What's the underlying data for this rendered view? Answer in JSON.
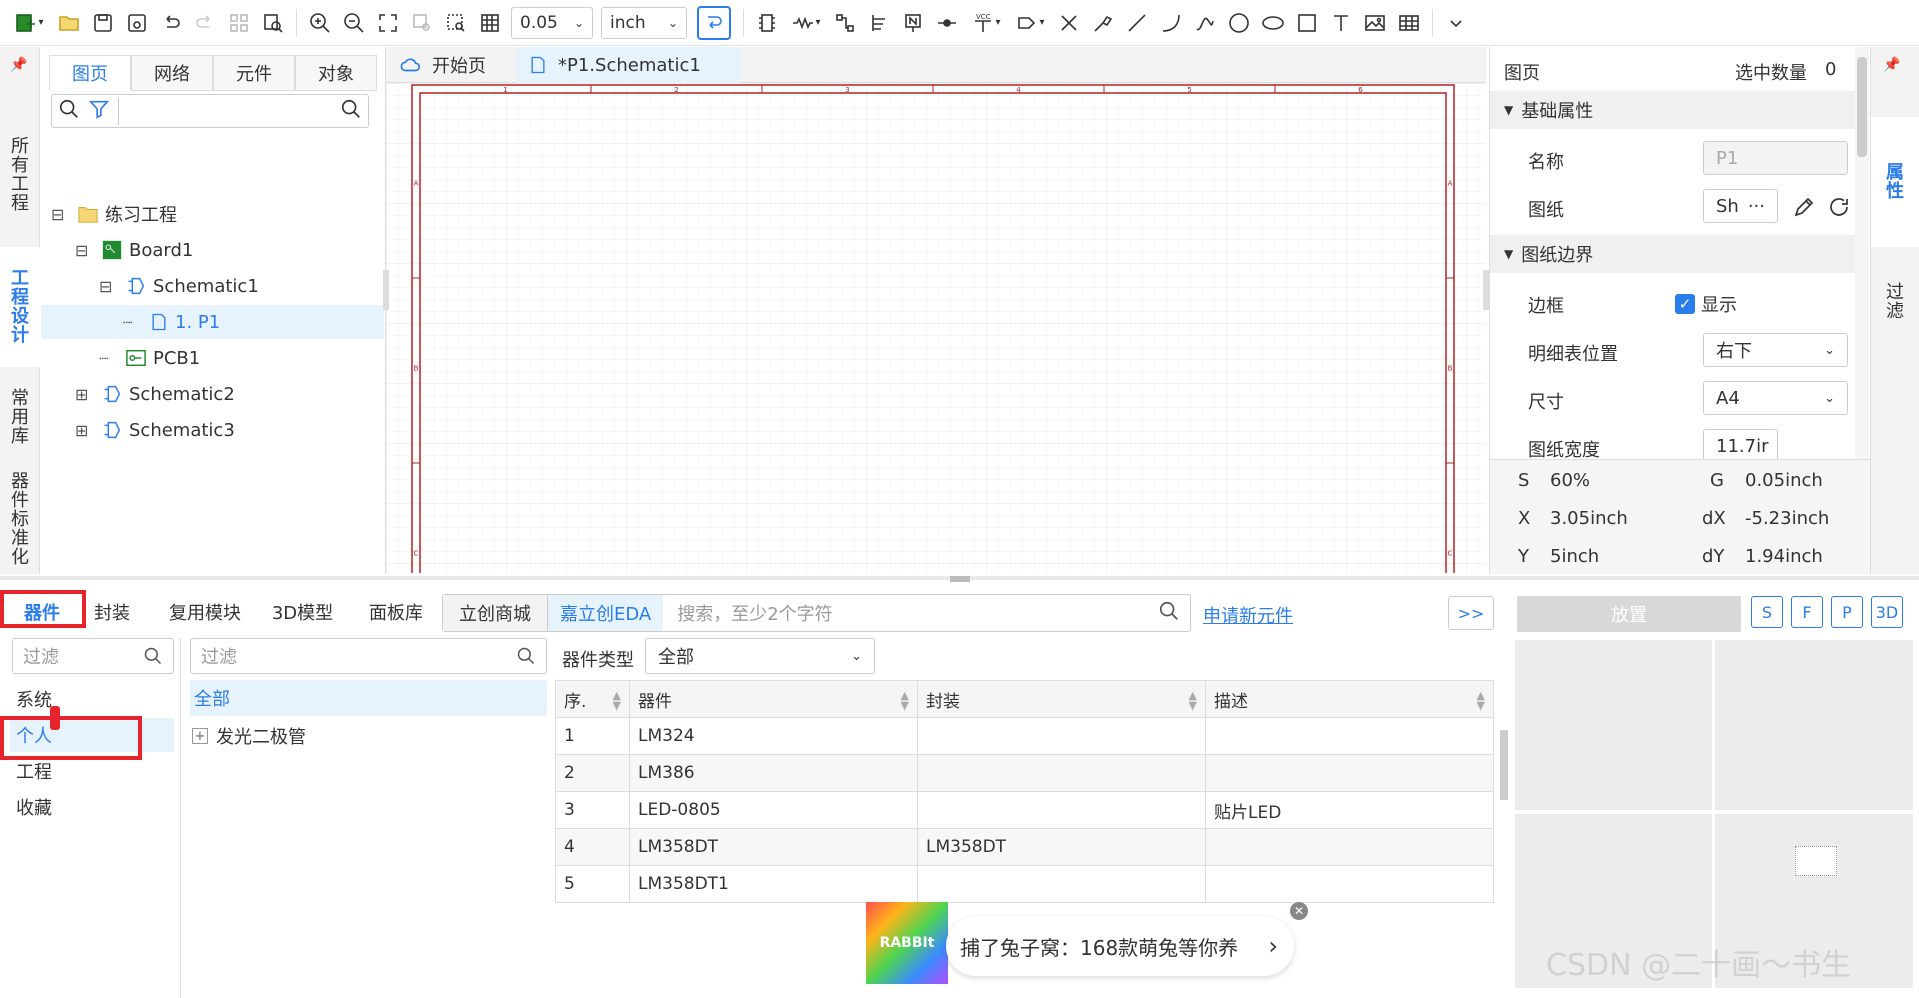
{
  "toolbar": {
    "grid_value": "0.05",
    "unit": "inch",
    "icons": [
      "new-project-icon",
      "open-folder-icon",
      "save-icon",
      "save-as-icon",
      "undo-icon",
      "redo-icon",
      "group-icon",
      "find-icon",
      "zoom-in-icon",
      "zoom-out-icon",
      "fit-icon",
      "zoom-area-icon",
      "select-area-icon",
      "grid-icon",
      "grid-size-select",
      "unit-select",
      "wire-mode-icon",
      "component-icon",
      "resistor-icon",
      "pin-icon",
      "bus-icon",
      "net-label-icon",
      "netflag-icon",
      "vcc-icon",
      "netport-icon",
      "no-connect-icon",
      "probe-icon",
      "line-icon",
      "arc-icon",
      "bezier-icon",
      "circle-icon",
      "ellipse-icon",
      "rectangle-icon",
      "text-icon",
      "image-icon",
      "table-icon",
      "more-icon"
    ]
  },
  "left_tabs": [
    "所有工程",
    "工程设计",
    "常用库",
    "器件标准化"
  ],
  "left_panel": {
    "tabs": [
      "图页",
      "网络",
      "元件",
      "对象"
    ],
    "tree": [
      {
        "label": "练习工程",
        "level": 0,
        "icon": "folder-icon",
        "toggle": "⊟"
      },
      {
        "label": "Board1",
        "level": 1,
        "icon": "board-icon",
        "toggle": "⊟"
      },
      {
        "label": "Schematic1",
        "level": 2,
        "icon": "schematic-icon",
        "toggle": "⊟"
      },
      {
        "label": "1. P1",
        "level": 3,
        "icon": "page-icon",
        "toggle": ""
      },
      {
        "label": "PCB1",
        "level": 2,
        "icon": "pcb-icon",
        "toggle": ""
      },
      {
        "label": "Schematic2",
        "level": 1,
        "icon": "schematic-icon",
        "toggle": "⊞"
      },
      {
        "label": "Schematic3",
        "level": 1,
        "icon": "schematic-icon",
        "toggle": "⊞"
      }
    ]
  },
  "editor": {
    "tabs": [
      "开始页",
      "*P1.Schematic1"
    ],
    "frame_cols": [
      "1",
      "2",
      "3",
      "4",
      "5",
      "6"
    ],
    "frame_rows": [
      "A",
      "B",
      "C"
    ]
  },
  "right_panel": {
    "title": "图页",
    "selected_label": "选中数量",
    "selected_count": "0",
    "section_basic": "基础属性",
    "name_label": "名称",
    "name_value": "P1",
    "sheet_label": "图纸",
    "sheet_value": "Sh",
    "section_border": "图纸边界",
    "border_label": "边框",
    "border_check": "显示",
    "title_pos_label": "明细表位置",
    "title_pos_value": "右下",
    "size_label": "尺寸",
    "size_value": "A4",
    "width_label": "图纸宽度",
    "width_value": "11.7ir",
    "status": {
      "s_label": "S",
      "s_value": "60%",
      "g_label": "G",
      "g_value": "0.05inch",
      "x_label": "X",
      "x_value": "3.05inch",
      "dx_label": "dX",
      "dx_value": "-5.23inch",
      "y_label": "Y",
      "y_value": "5inch",
      "dy_label": "dY",
      "dy_value": "1.94inch"
    }
  },
  "right_tabs": [
    "属性",
    "过滤"
  ],
  "bottom": {
    "tabs": [
      "器件",
      "封装",
      "复用模块",
      "3D模型",
      "面板库"
    ],
    "shop_tabs": [
      "立创商城",
      "嘉立创EDA"
    ],
    "search_placeholder": "搜索，至少2个字符",
    "apply_link": "申请新元件",
    "more_btn": ">>",
    "filter_placeholder": "过滤",
    "categories": [
      "系统",
      "个人",
      "工程",
      "收藏"
    ],
    "class_filter_placeholder": "过滤",
    "class_all": "全部",
    "class_items": [
      "发光二极管"
    ],
    "type_label": "器件类型",
    "type_value": "全部",
    "columns": [
      "序.",
      "器件",
      "封装",
      "描述"
    ],
    "rows": [
      [
        "1",
        "LM324",
        "",
        ""
      ],
      [
        "2",
        "LM386",
        "",
        ""
      ],
      [
        "3",
        "LED-0805",
        "",
        "贴片LED"
      ],
      [
        "4",
        "LM358DT",
        "LM358DT",
        ""
      ],
      [
        "5",
        "LM358DT1",
        "",
        ""
      ]
    ],
    "place_btn": "放置",
    "preview_btns": [
      "S",
      "F",
      "P",
      "3D"
    ],
    "ad_text": "捕了兔子窝：168款萌兔等你养",
    "ad_logo": "RABBIt",
    "ad_arrow": "›",
    "watermark": "CSDN @二十画～书生"
  },
  "colors": {
    "accent": "#2b7de9",
    "frame": "#b22222",
    "highlight": "#e5242b"
  }
}
